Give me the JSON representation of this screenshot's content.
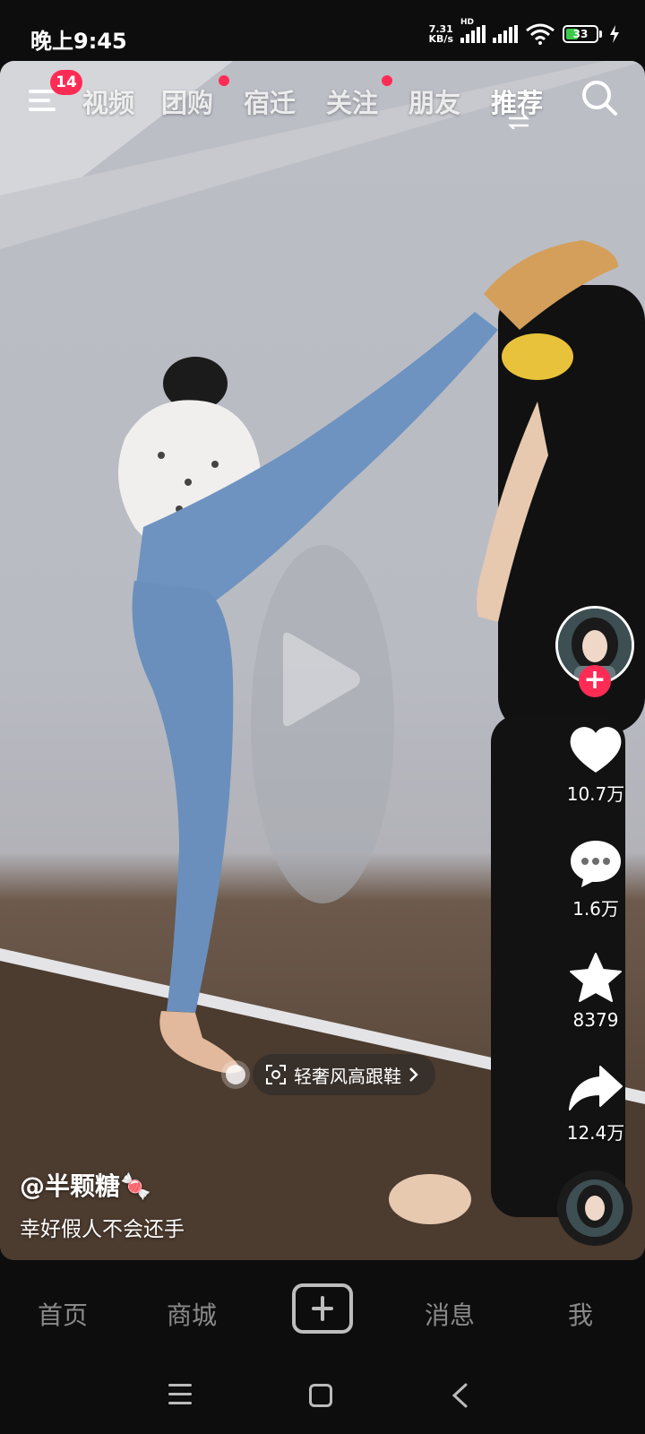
{
  "status_bar": {
    "time": "晚上9:45",
    "net_speed_value": "7.31",
    "net_speed_unit": "KB/s",
    "hd_label": "HD",
    "battery_level": "33"
  },
  "top_nav": {
    "menu_badge": "14",
    "tabs": [
      {
        "label": "视频",
        "dot": false
      },
      {
        "label": "团购",
        "dot": true
      },
      {
        "label": "宿迁",
        "dot": false
      },
      {
        "label": "关注",
        "dot": true
      },
      {
        "label": "朋友",
        "dot": false
      },
      {
        "label": "推荐",
        "dot": false,
        "active": true
      }
    ]
  },
  "video": {
    "product_tag": "轻奢风高跟鞋",
    "author": "@半颗糖🍬",
    "caption": "幸好假人不会还手"
  },
  "actions": {
    "likes": "10.7万",
    "comments": "1.6万",
    "favorites": "8379",
    "shares": "12.4万"
  },
  "bottom_nav": {
    "home": "首页",
    "mall": "商城",
    "messages": "消息",
    "me": "我"
  },
  "colors": {
    "accent": "#fe2c55",
    "background": "#0d0d0d"
  }
}
